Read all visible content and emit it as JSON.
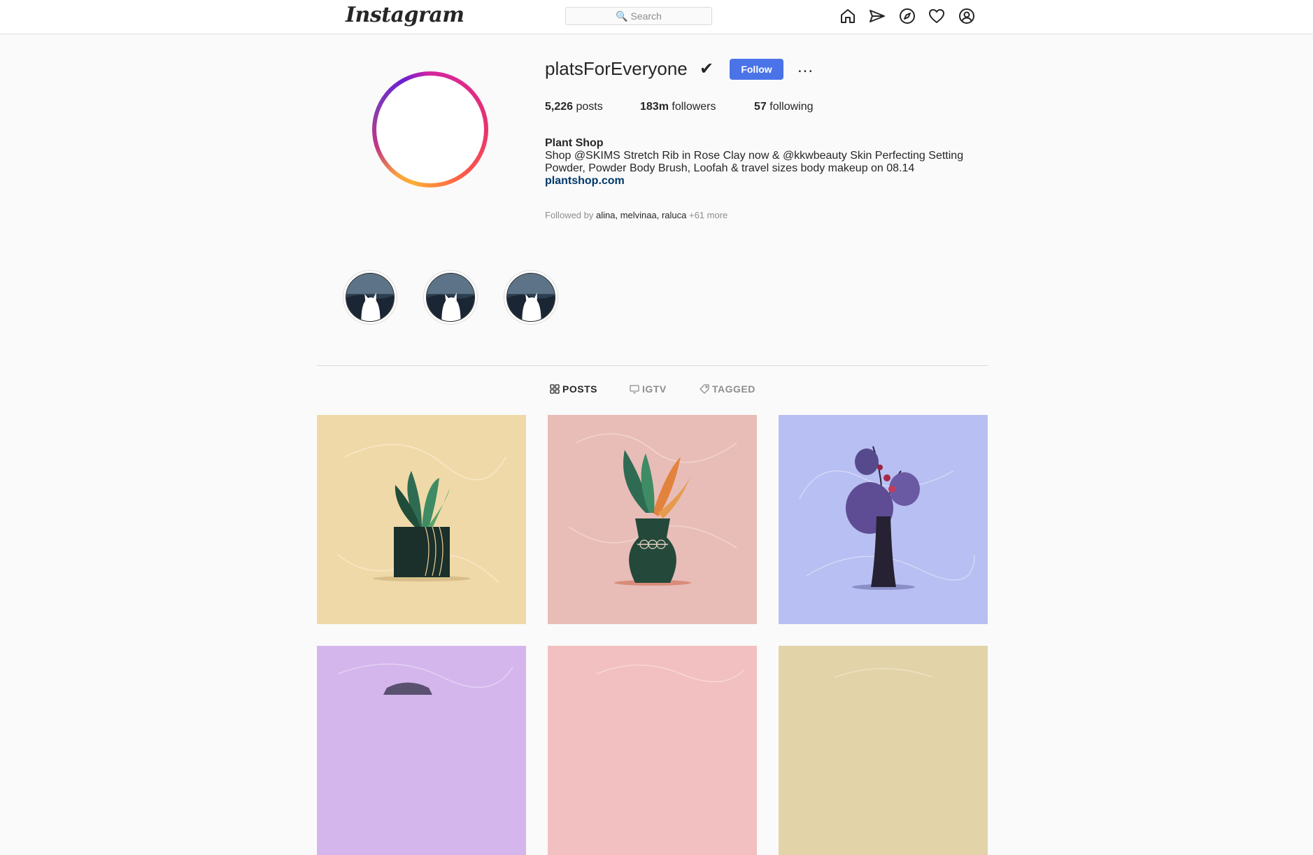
{
  "nav": {
    "logo": "Instagram",
    "search_placeholder": "🔍 Search",
    "icons": [
      "home-icon",
      "direct-icon",
      "explore-icon",
      "activity-icon",
      "profile-icon"
    ]
  },
  "profile": {
    "username": "platsForEveryone",
    "verified_mark": "✔",
    "follow_label": "Follow",
    "more_label": "...",
    "stats": {
      "posts_count": "5,226",
      "posts_label": "posts",
      "followers_count": "183m",
      "followers_label": "followers",
      "following_count": "57",
      "following_label": "following"
    },
    "bio": {
      "name": "Plant Shop",
      "text": "Shop @SKIMS Stretch Rib in Rose Clay now & @kkwbeauty Skin Perfecting Setting Powder, Powder Body Brush, Loofah & travel sizes body makeup on 08.14",
      "link": "plantshop.com"
    },
    "followed_by": {
      "prefix": "Followed by",
      "names": "alina, melvinaa, raluca",
      "more": "+61 more"
    }
  },
  "highlights_count": 3,
  "tabs": [
    {
      "label": "POSTS",
      "icon": "grid-icon",
      "active": true
    },
    {
      "label": "IGTV",
      "icon": "tv-icon",
      "active": false
    },
    {
      "label": "TAGGED",
      "icon": "tag-icon",
      "active": false
    }
  ],
  "colors": {
    "follow_button": "#4b73e8",
    "post_backgrounds": [
      "#f0d9a8",
      "#e8bdb8",
      "#b8bff2",
      "#d4b6ec",
      "#f2c0c0",
      "#e2d3a8"
    ]
  }
}
